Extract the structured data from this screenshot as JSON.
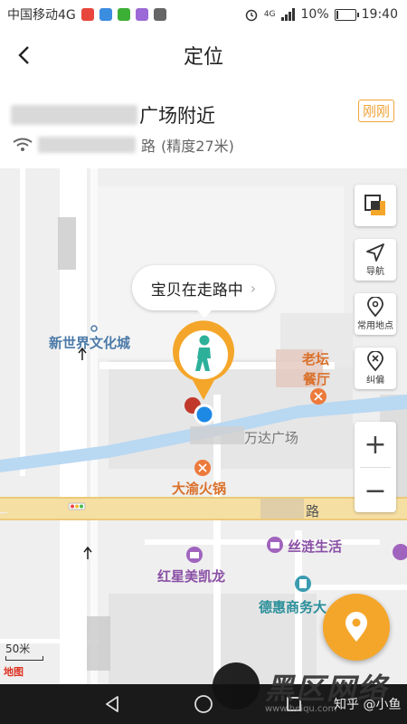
{
  "status_bar": {
    "carrier": "中国移动4G",
    "network": "4G",
    "battery": "10%",
    "battery_level": 0.1,
    "time": "19:40"
  },
  "header": {
    "title": "定位"
  },
  "location": {
    "address_visible": "广场附近",
    "badge": "刚刚",
    "street_visible": "路",
    "accuracy": "(精度27米)"
  },
  "map": {
    "bubble_text": "宝贝在走路中",
    "labels": {
      "new_world": "新世界文化城",
      "laotan_1": "老坛",
      "laotan_2": "餐厅",
      "wanda": "万达广场",
      "dayu": "大渝火锅",
      "road": "路",
      "silian": "丝涟生活",
      "hongxing": "红星美凯龙",
      "dehui": "德惠商务大"
    },
    "controls": {
      "nav": "导航",
      "common": "常用地点",
      "correct": "纠偏"
    },
    "zoom_in": "+",
    "zoom_out": "−",
    "scale": "50米",
    "map_logo": "地图"
  },
  "watermark": {
    "big_text": "黑区网络",
    "url": "www.heiqu.com",
    "credit": "知乎 @小鱼"
  },
  "colors": {
    "accent": "#f4a62a",
    "badge": "#f0a33a",
    "child_icon": "#2db09a",
    "location_dot": "#1e88e5"
  }
}
